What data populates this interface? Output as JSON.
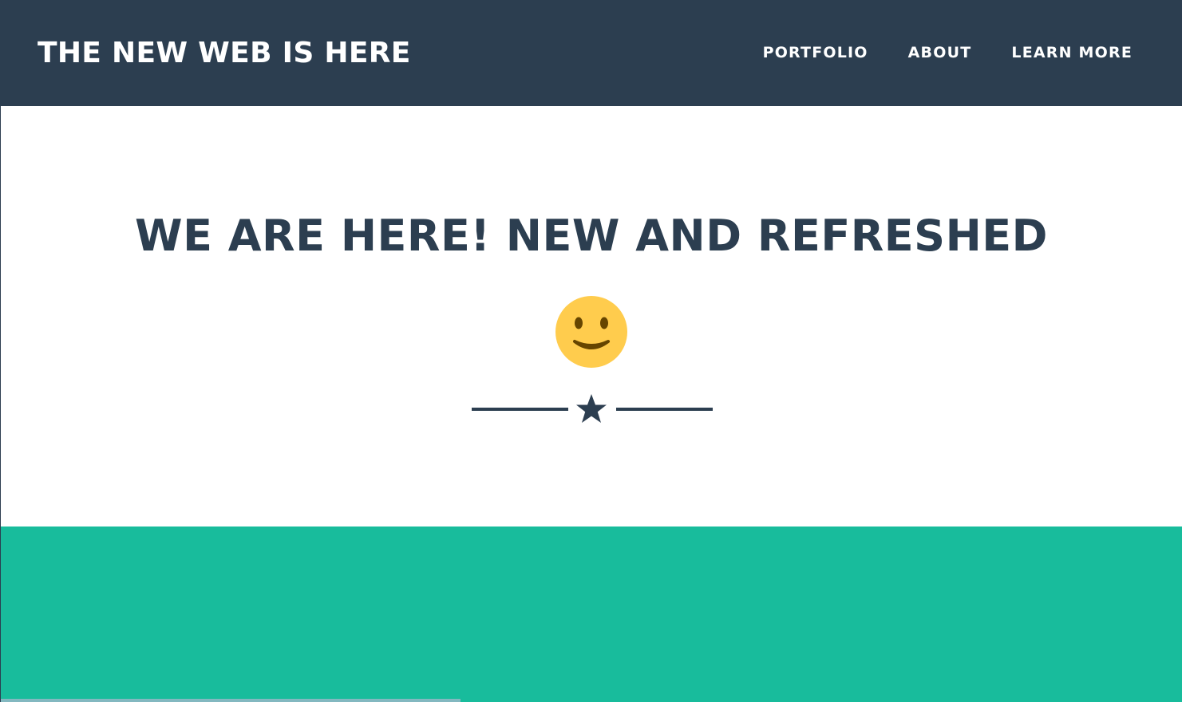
{
  "navbar": {
    "brand": "THE NEW WEB IS HERE",
    "links": [
      "PORTFOLIO",
      "ABOUT",
      "LEARN MORE"
    ]
  },
  "masthead": {
    "headline": "WE ARE HERE! NEW AND REFRESHED",
    "emoji_icon": "slightly-smiling-face-icon",
    "divider_icon": "star-icon"
  },
  "colors": {
    "primary": "#2c3e50",
    "accent": "#18bc9c",
    "emoji_yellow": "#ffcc4d",
    "background": "#ffffff"
  }
}
